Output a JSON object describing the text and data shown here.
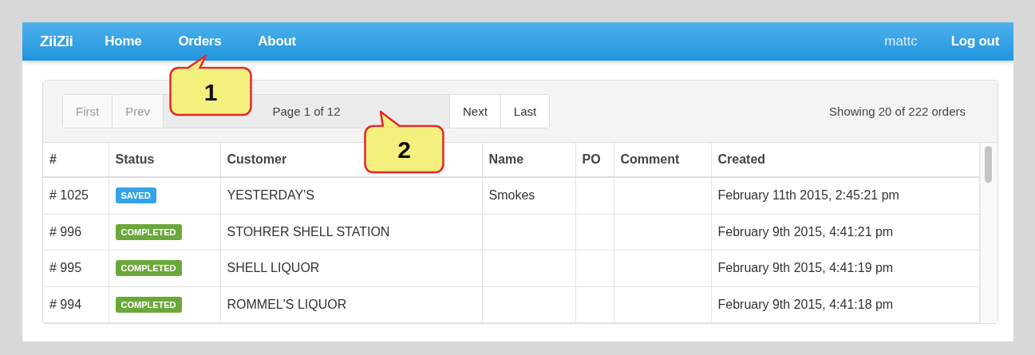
{
  "navbar": {
    "brand": "ZiiZii",
    "links": [
      "Home",
      "Orders",
      "About"
    ],
    "user": "mattc",
    "logout": "Log out"
  },
  "pagination": {
    "buttons": [
      {
        "label": "First",
        "disabled": true
      },
      {
        "label": "Prev",
        "disabled": true
      }
    ],
    "page": "Page 1 of 12",
    "buttons_after": [
      {
        "label": "Next",
        "disabled": false
      },
      {
        "label": "Last",
        "disabled": false
      }
    ],
    "summary": "Showing 20 of 222 orders"
  },
  "table": {
    "columns": [
      "#",
      "Status",
      "Customer",
      "Name",
      "PO",
      "Comment",
      "Created"
    ],
    "rows": [
      {
        "id": "# 1025",
        "status": {
          "label": "SAVED",
          "kind": "saved"
        },
        "customer": "YESTERDAY'S",
        "name": "Smokes",
        "created": "February 11th 2015, 2:45:21 pm"
      },
      {
        "id": "# 996",
        "status": {
          "label": "COMPLETED",
          "kind": "completed"
        },
        "customer": "STOHRER SHELL STATION",
        "created": "February 9th 2015, 4:41:21 pm"
      },
      {
        "id": "# 995",
        "status": {
          "label": "COMPLETED",
          "kind": "completed"
        },
        "customer": "SHELL LIQUOR",
        "created": "February 9th 2015, 4:41:19 pm"
      },
      {
        "id": "# 994",
        "status": {
          "label": "COMPLETED",
          "kind": "completed"
        },
        "customer": "ROMMEL'S LIQUOR",
        "created": "February 9th 2015, 4:41:18 pm"
      }
    ]
  },
  "callouts": [
    {
      "label": "1"
    },
    {
      "label": "2"
    }
  ]
}
